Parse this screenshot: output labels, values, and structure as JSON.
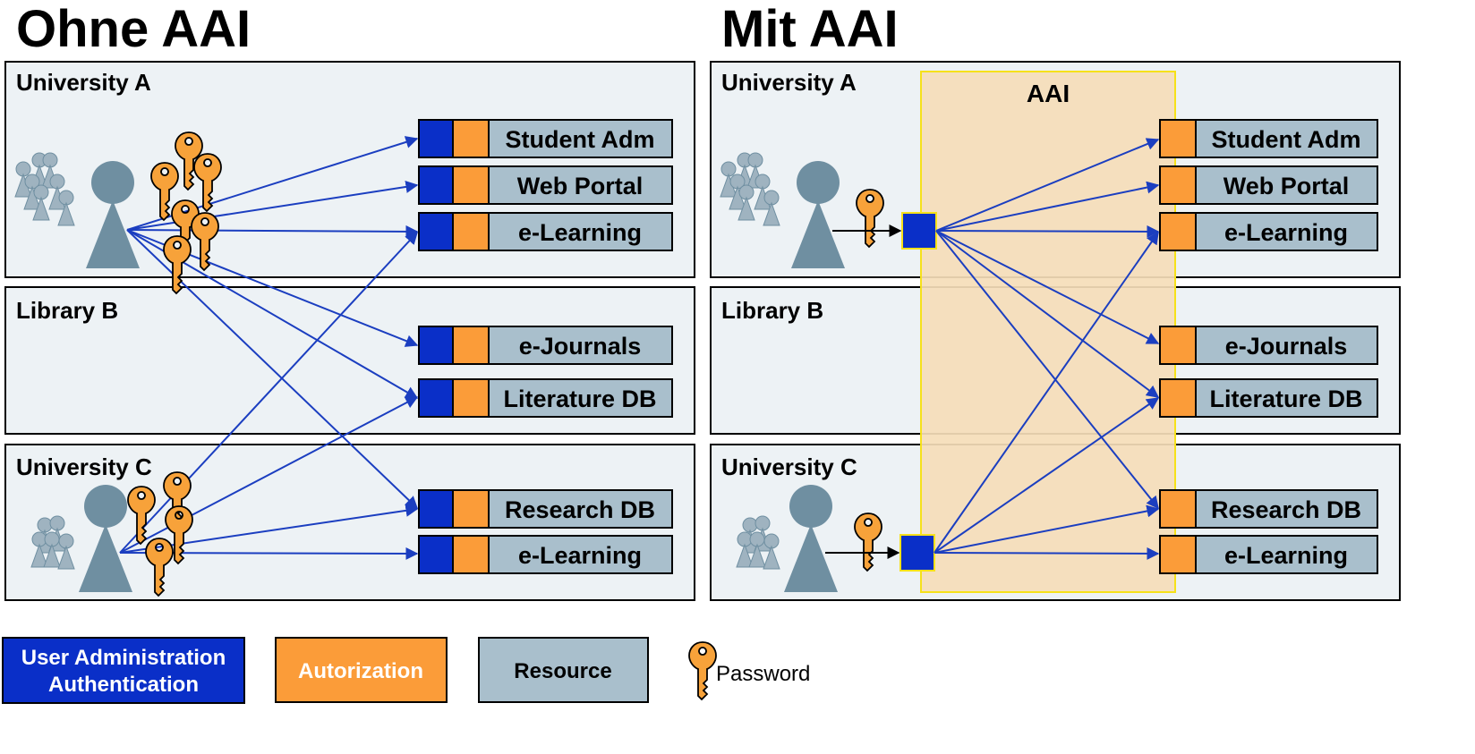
{
  "titles": {
    "left": "Ohne AAI",
    "right": "Mit AAI"
  },
  "zones": {
    "university_a": "University A",
    "library_b": "Library B",
    "university_c": "University C"
  },
  "aai_label": "AAI",
  "resources": {
    "student_adm": "Student Adm",
    "web_portal": "Web Portal",
    "e_learning": "e-Learning",
    "e_journals": "e-Journals",
    "literature_db": "Literature DB",
    "research_db": "Research DB"
  },
  "legend": {
    "user_admin_line1": "User Administration",
    "user_admin_line2": "Authentication",
    "authorization": "Autorization",
    "resource": "Resource",
    "password": "Password"
  },
  "colors": {
    "user_admin": "#0a2fc8",
    "authorization": "#fb9c39",
    "resource": "#a9bfcc",
    "zone_fill": "#edf2f5",
    "aai_fill": "#f5ddb8",
    "aai_border": "#f6e11a",
    "arrow": "#1b3ec0",
    "person": "#6f8fa1",
    "person_small": "#9fb3c0",
    "key": "#f7a23a"
  }
}
